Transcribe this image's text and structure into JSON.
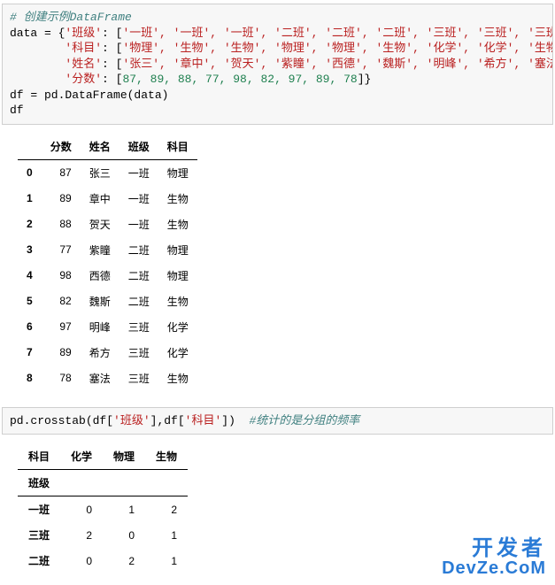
{
  "code1": {
    "comment": "# 创建示例DataFrame",
    "l1a": "data = {",
    "l1k": "'班级'",
    "l1b": ": [",
    "l1v": "'一班', '一班', '一班', '二班', '二班', '二班', '三班', '三班', '三班'",
    "l1c": "],",
    "l2pad": "        ",
    "l2k": "'科目'",
    "l2b": ": [",
    "l2v": "'物理', '生物', '生物', '物理', '物理', '生物', '化学', '化学', '生物'",
    "l2c": "],",
    "l3k": "'姓名'",
    "l3b": ": [",
    "l3v": "'张三', '章中', '贺天', '紫瞳', '西德', '魏斯', '明峰', '希方', '塞法'",
    "l3c": "],",
    "l4k": "'分数'",
    "l4b": ": [",
    "l4v": "87, 89, 88, 77, 98, 82, 97, 89, 78",
    "l4c": "]}",
    "l5": "df = pd.DataFrame(data)",
    "l6": "df"
  },
  "table1": {
    "headers": [
      "分数",
      "姓名",
      "班级",
      "科目"
    ],
    "rows": [
      {
        "idx": "0",
        "分数": "87",
        "姓名": "张三",
        "班级": "一班",
        "科目": "物理"
      },
      {
        "idx": "1",
        "分数": "89",
        "姓名": "章中",
        "班级": "一班",
        "科目": "生物"
      },
      {
        "idx": "2",
        "分数": "88",
        "姓名": "贺天",
        "班级": "一班",
        "科目": "生物"
      },
      {
        "idx": "3",
        "分数": "77",
        "姓名": "紫瞳",
        "班级": "二班",
        "科目": "物理"
      },
      {
        "idx": "4",
        "分数": "98",
        "姓名": "西德",
        "班级": "二班",
        "科目": "物理"
      },
      {
        "idx": "5",
        "分数": "82",
        "姓名": "魏斯",
        "班级": "二班",
        "科目": "生物"
      },
      {
        "idx": "6",
        "分数": "97",
        "姓名": "明峰",
        "班级": "三班",
        "科目": "化学"
      },
      {
        "idx": "7",
        "分数": "89",
        "姓名": "希方",
        "班级": "三班",
        "科目": "化学"
      },
      {
        "idx": "8",
        "分数": "78",
        "姓名": "塞法",
        "班级": "三班",
        "科目": "生物"
      }
    ]
  },
  "code2": {
    "a": "pd.crosstab(df[",
    "k1": "'班级'",
    "b": "],df[",
    "k2": "'科目'",
    "c": "])  ",
    "comment": "#统计的是分组的频率"
  },
  "table2": {
    "colname": "科目",
    "cols": [
      "化学",
      "物理",
      "生物"
    ],
    "rowname": "班级",
    "rows": [
      {
        "idx": "一班",
        "v": [
          "0",
          "1",
          "2"
        ]
      },
      {
        "idx": "三班",
        "v": [
          "2",
          "0",
          "1"
        ]
      },
      {
        "idx": "二班",
        "v": [
          "0",
          "2",
          "1"
        ]
      }
    ]
  },
  "watermark": {
    "l1": "开发者",
    "l2": "DevZe.CoM"
  }
}
